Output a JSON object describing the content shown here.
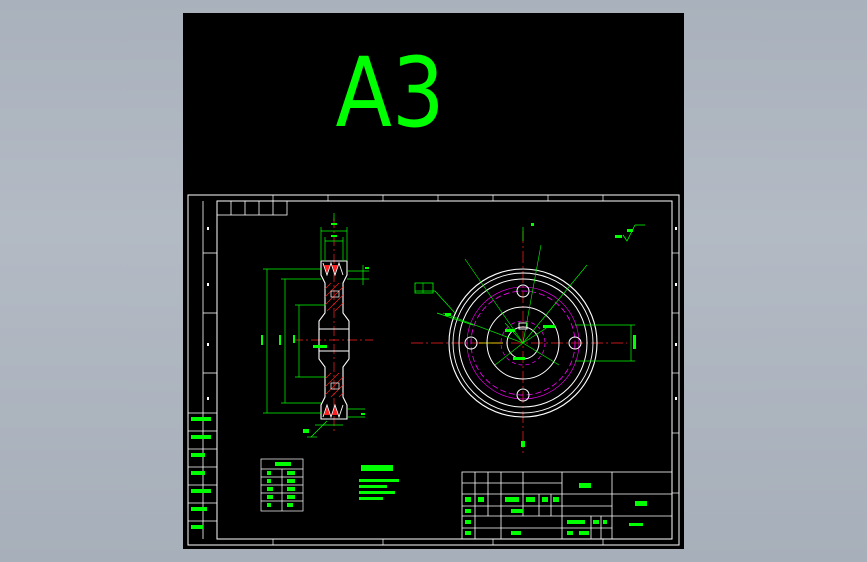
{
  "viewport": {
    "background": "#000000"
  },
  "drawing": {
    "sheet_size": "A3",
    "scale": "1:1",
    "colors": {
      "border": "#ffffff",
      "outline": "#ffffff",
      "dimension": "#00ff00",
      "centerline": "#ff2020",
      "hidden": "#ff00ff",
      "text": "#00ff00",
      "sheet_label": "#00ff00",
      "yellow_line": "#ffff00"
    }
  }
}
